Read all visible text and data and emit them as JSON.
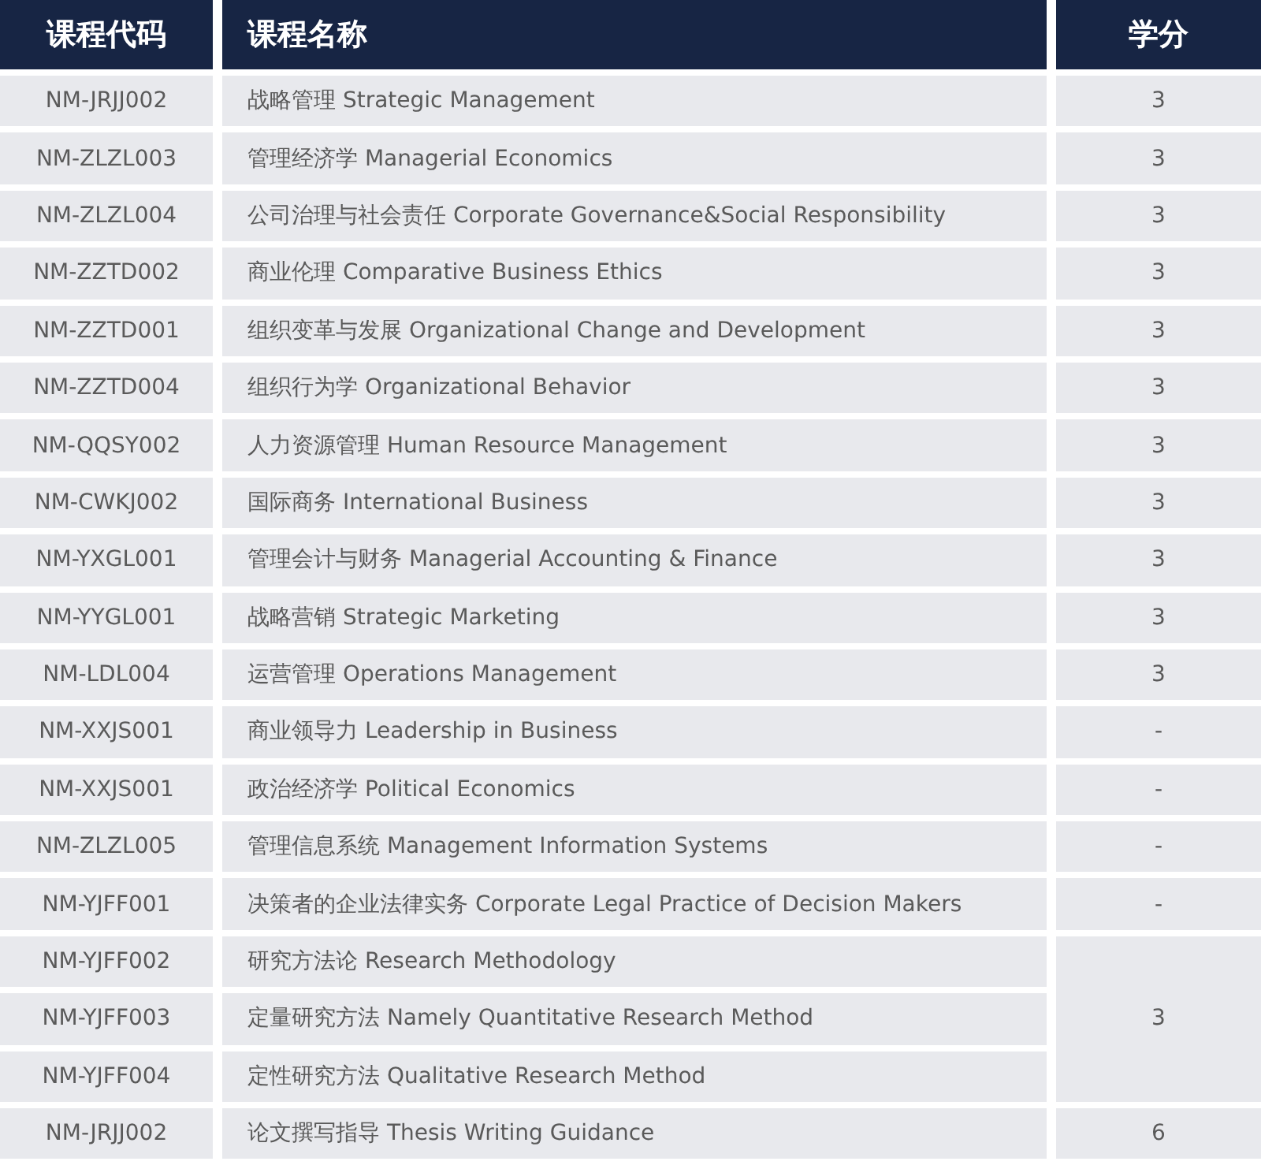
{
  "table": {
    "columns": [
      "课程代码",
      "课程名称",
      "学分"
    ],
    "groups": [
      {
        "credit": "3",
        "rows": [
          {
            "code": "NM-JRJJ002",
            "name": "战略管理 Strategic Management"
          }
        ]
      },
      {
        "credit": "3",
        "rows": [
          {
            "code": "NM-ZLZL003",
            "name": "管理经济学 Managerial Economics"
          }
        ]
      },
      {
        "credit": "3",
        "rows": [
          {
            "code": "NM-ZLZL004",
            "name": "公司治理与社会责任 Corporate Governance&Social Responsibility"
          }
        ]
      },
      {
        "credit": "3",
        "rows": [
          {
            "code": "NM-ZZTD002",
            "name": "商业伦理 Comparative Business Ethics"
          }
        ]
      },
      {
        "credit": "3",
        "rows": [
          {
            "code": "NM-ZZTD001",
            "name": "组织变革与发展 Organizational Change and Development"
          }
        ]
      },
      {
        "credit": "3",
        "rows": [
          {
            "code": "NM-ZZTD004",
            "name": "组织行为学 Organizational Behavior"
          }
        ]
      },
      {
        "credit": "3",
        "rows": [
          {
            "code": "NM-QQSY002",
            "name": "人力资源管理 Human Resource Management"
          }
        ]
      },
      {
        "credit": "3",
        "rows": [
          {
            "code": "NM-CWKJ002",
            "name": "国际商务 International Business"
          }
        ]
      },
      {
        "credit": "3",
        "rows": [
          {
            "code": "NM-YXGL001",
            "name": "管理会计与财务 Managerial Accounting & Finance"
          }
        ]
      },
      {
        "credit": "3",
        "rows": [
          {
            "code": "NM-YYGL001",
            "name": "战略营销 Strategic Marketing"
          }
        ]
      },
      {
        "credit": "3",
        "rows": [
          {
            "code": "NM-LDL004",
            "name": "运营管理 Operations Management"
          }
        ]
      },
      {
        "credit": "-",
        "rows": [
          {
            "code": "NM-XXJS001",
            "name": "商业领导力 Leadership in Business"
          }
        ]
      },
      {
        "credit": "-",
        "rows": [
          {
            "code": "NM-XXJS001",
            "name": "政治经济学 Political Economics"
          }
        ]
      },
      {
        "credit": "-",
        "rows": [
          {
            "code": "NM-ZLZL005",
            "name": "管理信息系统 Management Information Systems"
          }
        ]
      },
      {
        "credit": "-",
        "rows": [
          {
            "code": "NM-YJFF001",
            "name": "决策者的企业法律实务 Corporate Legal Practice of Decision Makers"
          }
        ]
      },
      {
        "credit": "3",
        "rows": [
          {
            "code": "NM-YJFF002",
            "name": "研究方法论 Research Methodology"
          },
          {
            "code": "NM-YJFF003",
            "name": "定量研究方法 Namely Quantitative Research Method"
          },
          {
            "code": "NM-YJFF004",
            "name": "定性研究方法 Qualitative Research Method"
          }
        ]
      },
      {
        "credit": "6",
        "rows": [
          {
            "code": "NM-JRJJ002",
            "name": "论文撰写指导 Thesis Writing Guidance"
          }
        ]
      }
    ]
  }
}
